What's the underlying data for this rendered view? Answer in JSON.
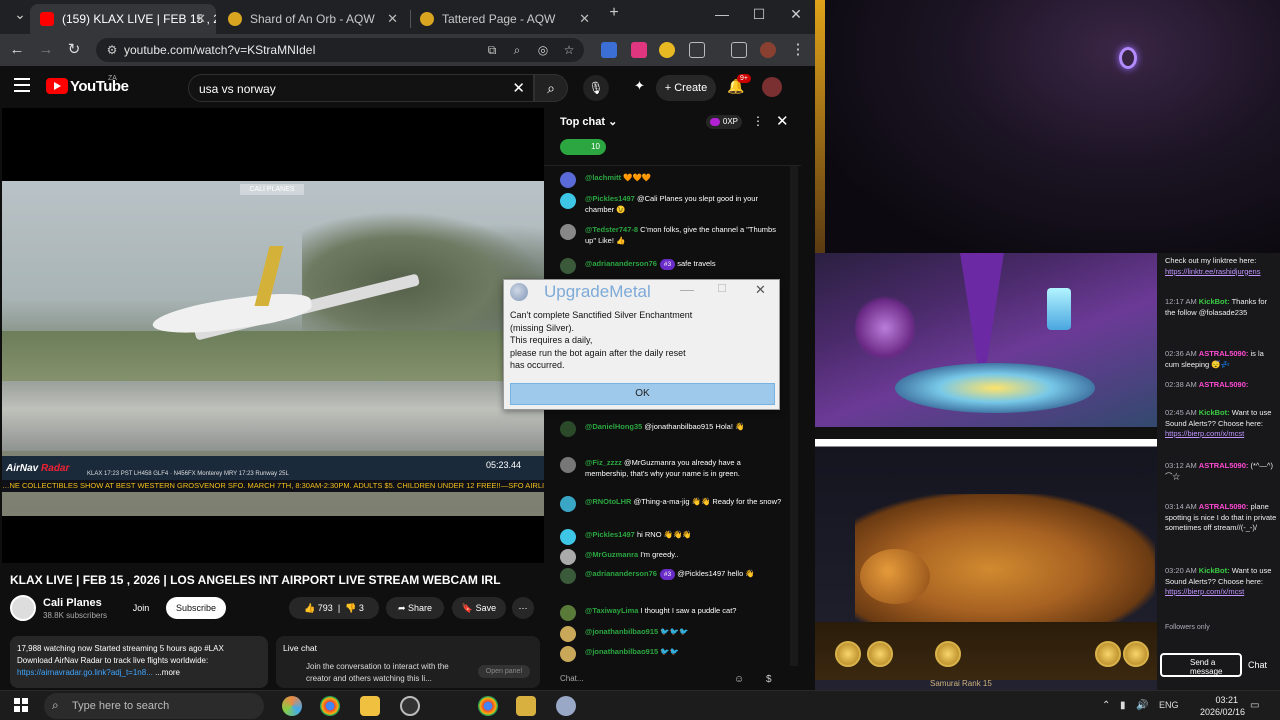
{
  "browser": {
    "tabs": [
      {
        "label": "(159) KLAX LIVE | FEB 15 , 2",
        "active": true
      },
      {
        "label": "Shard of An Orb - AQW",
        "active": false
      },
      {
        "label": "Tattered Page - AQW",
        "active": false
      }
    ],
    "url": "youtube.com/watch?v=KStraMNIdeI"
  },
  "youtube": {
    "logo_text": "YouTube",
    "region": "ZA",
    "search_query": "usa vs norway",
    "create_label": "Create",
    "notification_count": "9+"
  },
  "video": {
    "camera_tag": "CALI PLANES",
    "airnav_brand_1": "AirNav",
    "airnav_brand_2": "Radar",
    "flight_row": "KLAX   17:23 PST    LH458   GLF4 · N456FX    Monterey MRY    17:23    Runway 25L",
    "flight_time": "05:23.44",
    "ticker": "…NE COLLECTIBLES SHOW AT BEST WESTERN GROSVENOR SFO. MARCH 7TH, 8:30AM-2:30PM. ADULTS $5. CHILDREN UNDER 12 FREE!!—SFO AIRLINE"
  },
  "watch": {
    "title": "KLAX LIVE | FEB 15 , 2026 | LOS ANGELES INT AIRPORT LIVE STREAM WEBCAM IRL",
    "channel_name": "Cali Planes",
    "subscribers": "38.8K subscribers",
    "join_label": "Join",
    "subscribe_label": "Subscribe",
    "likes": "793",
    "dislikes": "3",
    "share_label": "Share",
    "save_label": "Save",
    "desc_line1": "17,988 watching now  Started streaming 5 hours ago  #LAX",
    "desc_line2": "Download AirNav Radar to track live flights worldwide:",
    "desc_link": "https://airnavradar.go.link?adj_t=1n8...",
    "desc_more": "...more",
    "livechat_title": "Live chat",
    "livechat_text": "Join the conversation to interact with the creator and others watching this li...",
    "open_panel": "Open panel"
  },
  "chat": {
    "title": "Top chat",
    "xp": "0XP",
    "viewers": "10",
    "input_placeholder": "Chat...",
    "messages": [
      {
        "user": "@lachmitt",
        "text": "🧡🧡🧡",
        "badge": ""
      },
      {
        "user": "@Pickles1497",
        "text": "@Cali Planes you slept good in your chamber 😉",
        "badge": ""
      },
      {
        "user": "@Tedster747-8",
        "text": "C'mon folks, give the channel a \"Thumbs up\" Like! 👍",
        "badge": ""
      },
      {
        "user": "@adriananderson76",
        "text": "safe travels",
        "badge": "#3"
      },
      {
        "user": "@DanielHong35",
        "text": "@jonathanbilbao915 Hola! 👋",
        "badge": ""
      },
      {
        "user": "@Fiz_zzzz",
        "text": "@MrGuzmanra you already have a membership, that's why your name is in green.",
        "badge": ""
      },
      {
        "user": "@RNOtoLHR",
        "text": "@Thing-a-ma-jig 👋👋 Ready for the snow?",
        "badge": ""
      },
      {
        "user": "@Pickles1497",
        "text": "hi RNO 👋👋👋",
        "badge": ""
      },
      {
        "user": "@MrGuzmanra",
        "text": "I'm greedy..",
        "badge": ""
      },
      {
        "user": "@adriananderson76",
        "text": "@Pickles1497 hello 👋",
        "badge": "#3"
      },
      {
        "user": "@TaxiwayLima",
        "text": "I thought I saw a puddle cat?",
        "badge": ""
      },
      {
        "user": "@jonathanbilbao915",
        "text": "🐦🐦🐦",
        "badge": ""
      },
      {
        "user": "@jonathanbilbao915",
        "text": "🐦🐦",
        "badge": ""
      }
    ]
  },
  "dialog": {
    "title": "UpgradeMetal",
    "message_1": "Can't complete Sanctified Silver Enchantment",
    "message_2": "(missing Silver).",
    "message_3": "This requires a daily,",
    "message_4": "please run the bot again after the daily reset",
    "message_5": "has occurred.",
    "ok_label": "OK"
  },
  "game": {
    "rank_label": "Samurai Rank 15"
  },
  "twitch": {
    "messages": [
      {
        "time": "",
        "user": "",
        "text": "Check out my linktree here:",
        "link": "https://linktr.ee/rashidjurgens"
      },
      {
        "time": "12:17 AM",
        "user": "KickBot:",
        "text": "Thanks for the follow @folasade235",
        "link": ""
      },
      {
        "time": "02:36 AM",
        "user": "ASTRAL5090:",
        "text": "is la cum sleeping 😴💤",
        "link": ""
      },
      {
        "time": "02:38 AM",
        "user": "ASTRAL5090:",
        "text": "",
        "link": ""
      },
      {
        "time": "02:45 AM",
        "user": "KickBot:",
        "text": "Want to use Sound Alerts?? Choose here:",
        "link": "https://bierp.com/x/mcst"
      },
      {
        "time": "03:12 AM",
        "user": "ASTRAL5090:",
        "text": "(*^—^) ⌒☆",
        "link": ""
      },
      {
        "time": "03:14 AM",
        "user": "ASTRAL5090:",
        "text": "plane spotting is nice I do that in private sometimes off stream//(-_-)/",
        "link": ""
      },
      {
        "time": "03:20 AM",
        "user": "KickBot:",
        "text": "Want to use Sound Alerts?? Choose here:",
        "link": "https://bierp.com/x/mcst"
      }
    ],
    "followers_only": "Followers only",
    "send_placeholder": "Send a message",
    "chat_label": "Chat"
  },
  "taskbar": {
    "search_placeholder": "Type here to search",
    "language": "ENG",
    "time": "03:21",
    "date": "2026/02/16"
  },
  "colors": {
    "yt_red": "#ff0000",
    "chat_green": "#2ba640",
    "twitch_purple": "#bf94ff",
    "dialog_button": "#9ec9ea"
  }
}
